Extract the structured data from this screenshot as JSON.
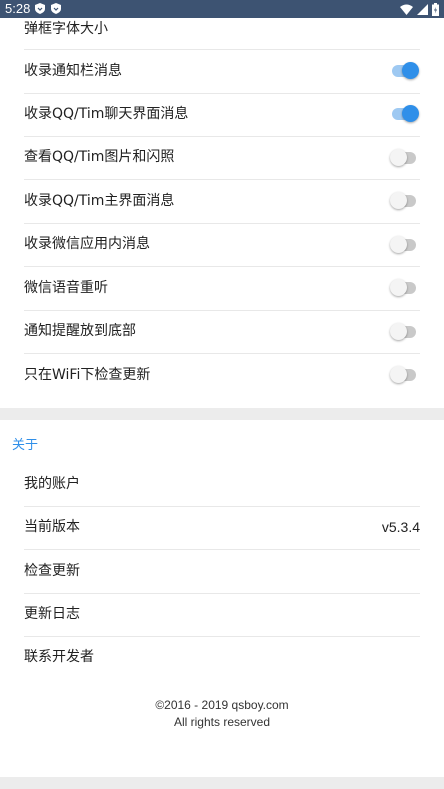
{
  "status_bar": {
    "time": "5:28",
    "icons_left": [
      "shield-icon",
      "shield-icon"
    ],
    "icons_right": [
      "wifi-icon",
      "cell-signal-icon",
      "battery-icon"
    ],
    "bg_color": "#3d5372"
  },
  "settings": {
    "partial_item_label": "弹框字体大小",
    "toggle_items": [
      {
        "label": "收录通知栏消息",
        "enabled": true
      },
      {
        "label": "收录QQ/Tim聊天界面消息",
        "enabled": true
      },
      {
        "label": "查看QQ/Tim图片和闪照",
        "enabled": false
      },
      {
        "label": "收录QQ/Tim主界面消息",
        "enabled": false
      },
      {
        "label": "收录微信应用内消息",
        "enabled": false
      },
      {
        "label": "微信语音重听",
        "enabled": false
      },
      {
        "label": "通知提醒放到底部",
        "enabled": false
      },
      {
        "label": "只在WiFi下检查更新",
        "enabled": false
      }
    ]
  },
  "about": {
    "section_title": "关于",
    "items": [
      {
        "label": "我的账户",
        "value": ""
      },
      {
        "label": "当前版本",
        "value": "v5.3.4"
      },
      {
        "label": "检查更新",
        "value": ""
      },
      {
        "label": "更新日志",
        "value": ""
      },
      {
        "label": "联系开发者",
        "value": ""
      }
    ]
  },
  "footer": {
    "copyright": "©2016 - 2019 qsboy.com",
    "rights": "All rights reserved"
  },
  "colors": {
    "accent": "#2f8fe9",
    "switch_on_track": "#9ec9f2",
    "switch_off_track": "#c9c9c9",
    "section_band": "#ececec"
  }
}
